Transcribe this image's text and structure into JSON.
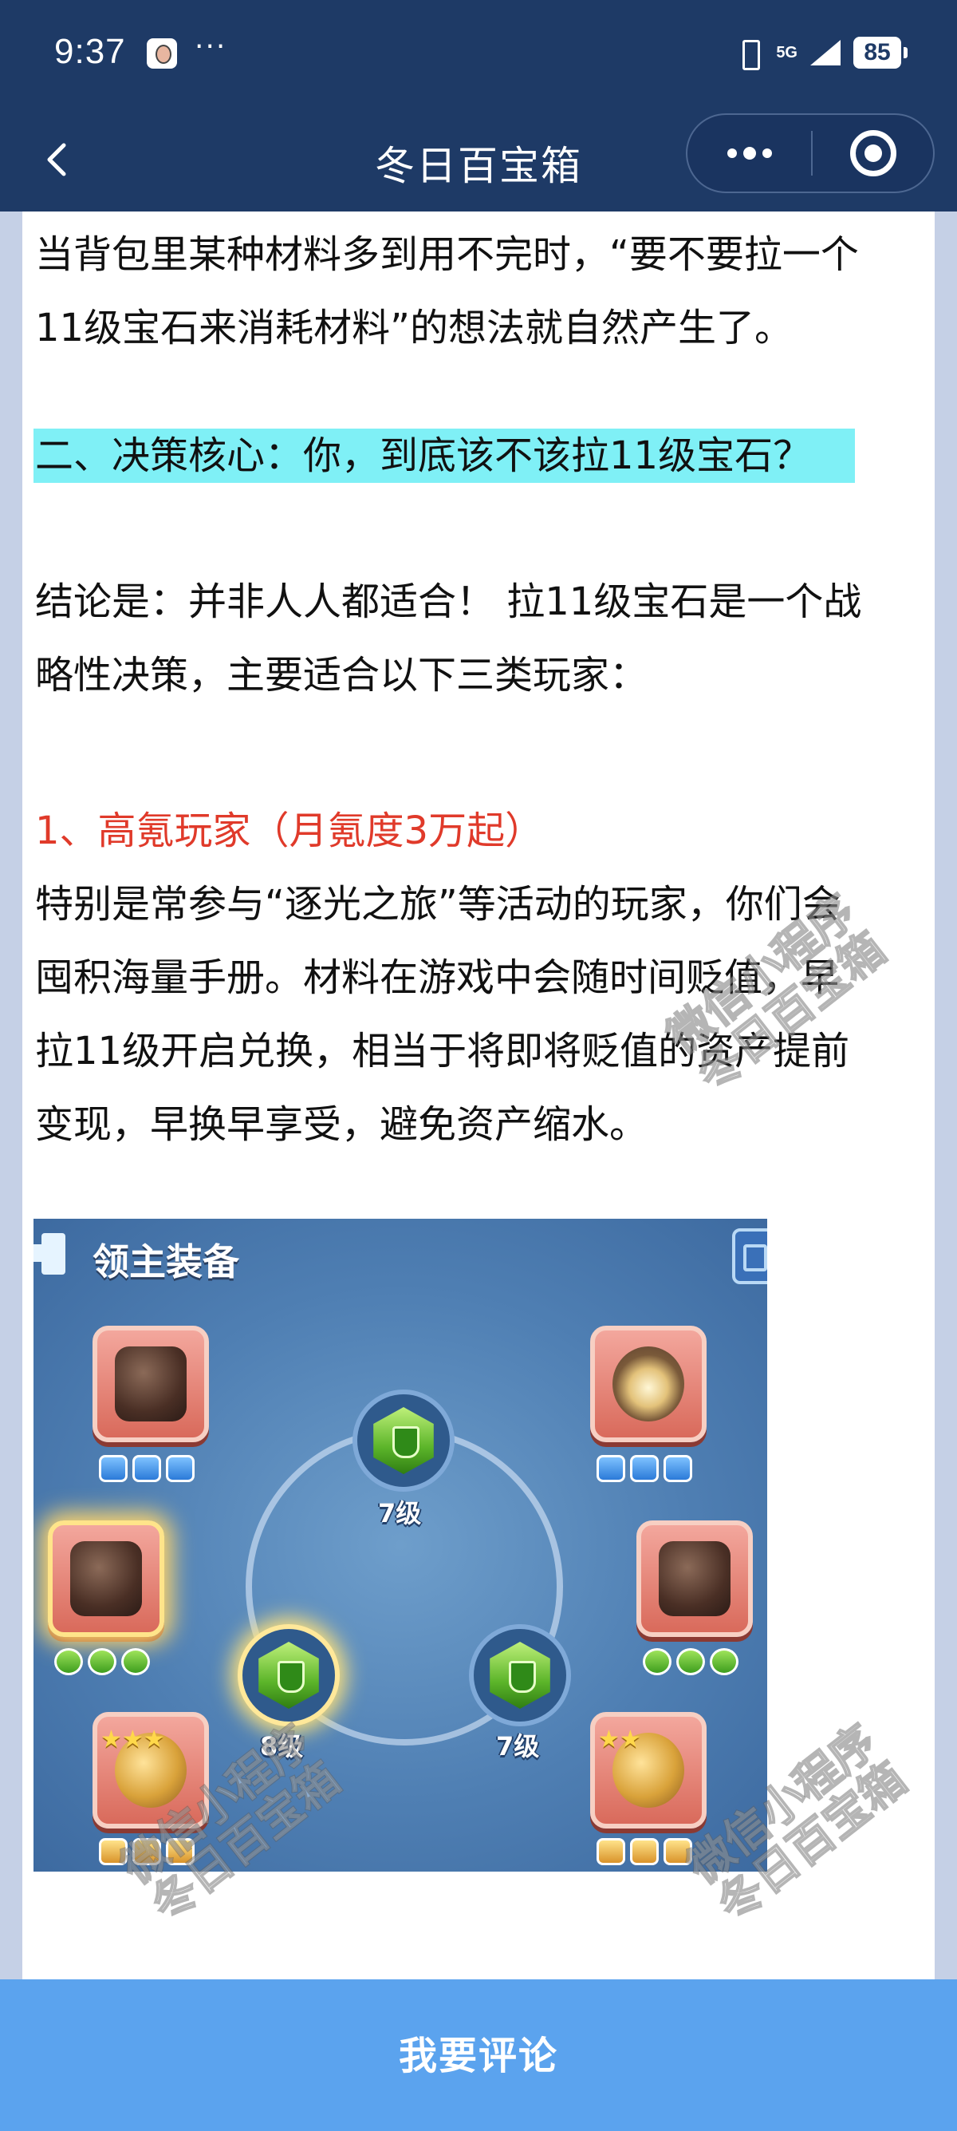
{
  "status_bar": {
    "time": "9:37",
    "more": "···",
    "network": "5G",
    "battery": "85"
  },
  "nav": {
    "title": "冬日百宝箱"
  },
  "article": {
    "para_1_line_1": "当背包里某种材料多到用不完时，“要不要拉一个",
    "para_1_line_2": "11级宝石来消耗材料”的想法就自然产生了。",
    "section_heading": "二、决策核心：你，到底该不该拉11级宝石？",
    "para_2_line_1": "结论是：并非人人都适合！ 拉11级宝石是一个战",
    "para_2_line_2": "略性决策，主要适合以下三类玩家：",
    "subheading": "1、高氪玩家（月氪度3万起）",
    "para_3_line_1": "特别是常参与“逐光之旅”等活动的玩家，你们会",
    "para_3_line_2": "囤积海量手册。材料在游戏中会随时间贬值，早",
    "para_3_line_3": "拉11级开启兑换，相当于将即将贬值的资产提前",
    "para_3_line_4": "变现，早换早享受，避免资产缩水。"
  },
  "game_screenshot": {
    "title": "领主装备",
    "gem_levels": [
      "7级",
      "8级",
      "7级"
    ]
  },
  "watermark": {
    "line_1": "微信小程序",
    "line_2": "冬日百宝箱"
  },
  "footer": {
    "comment_label": "我要评论"
  },
  "colors": {
    "header_bg": "#1e3a66",
    "highlight": "#7ff0f6",
    "red_heading": "#e03a2a",
    "comment_bar": "#5ba3ee"
  }
}
